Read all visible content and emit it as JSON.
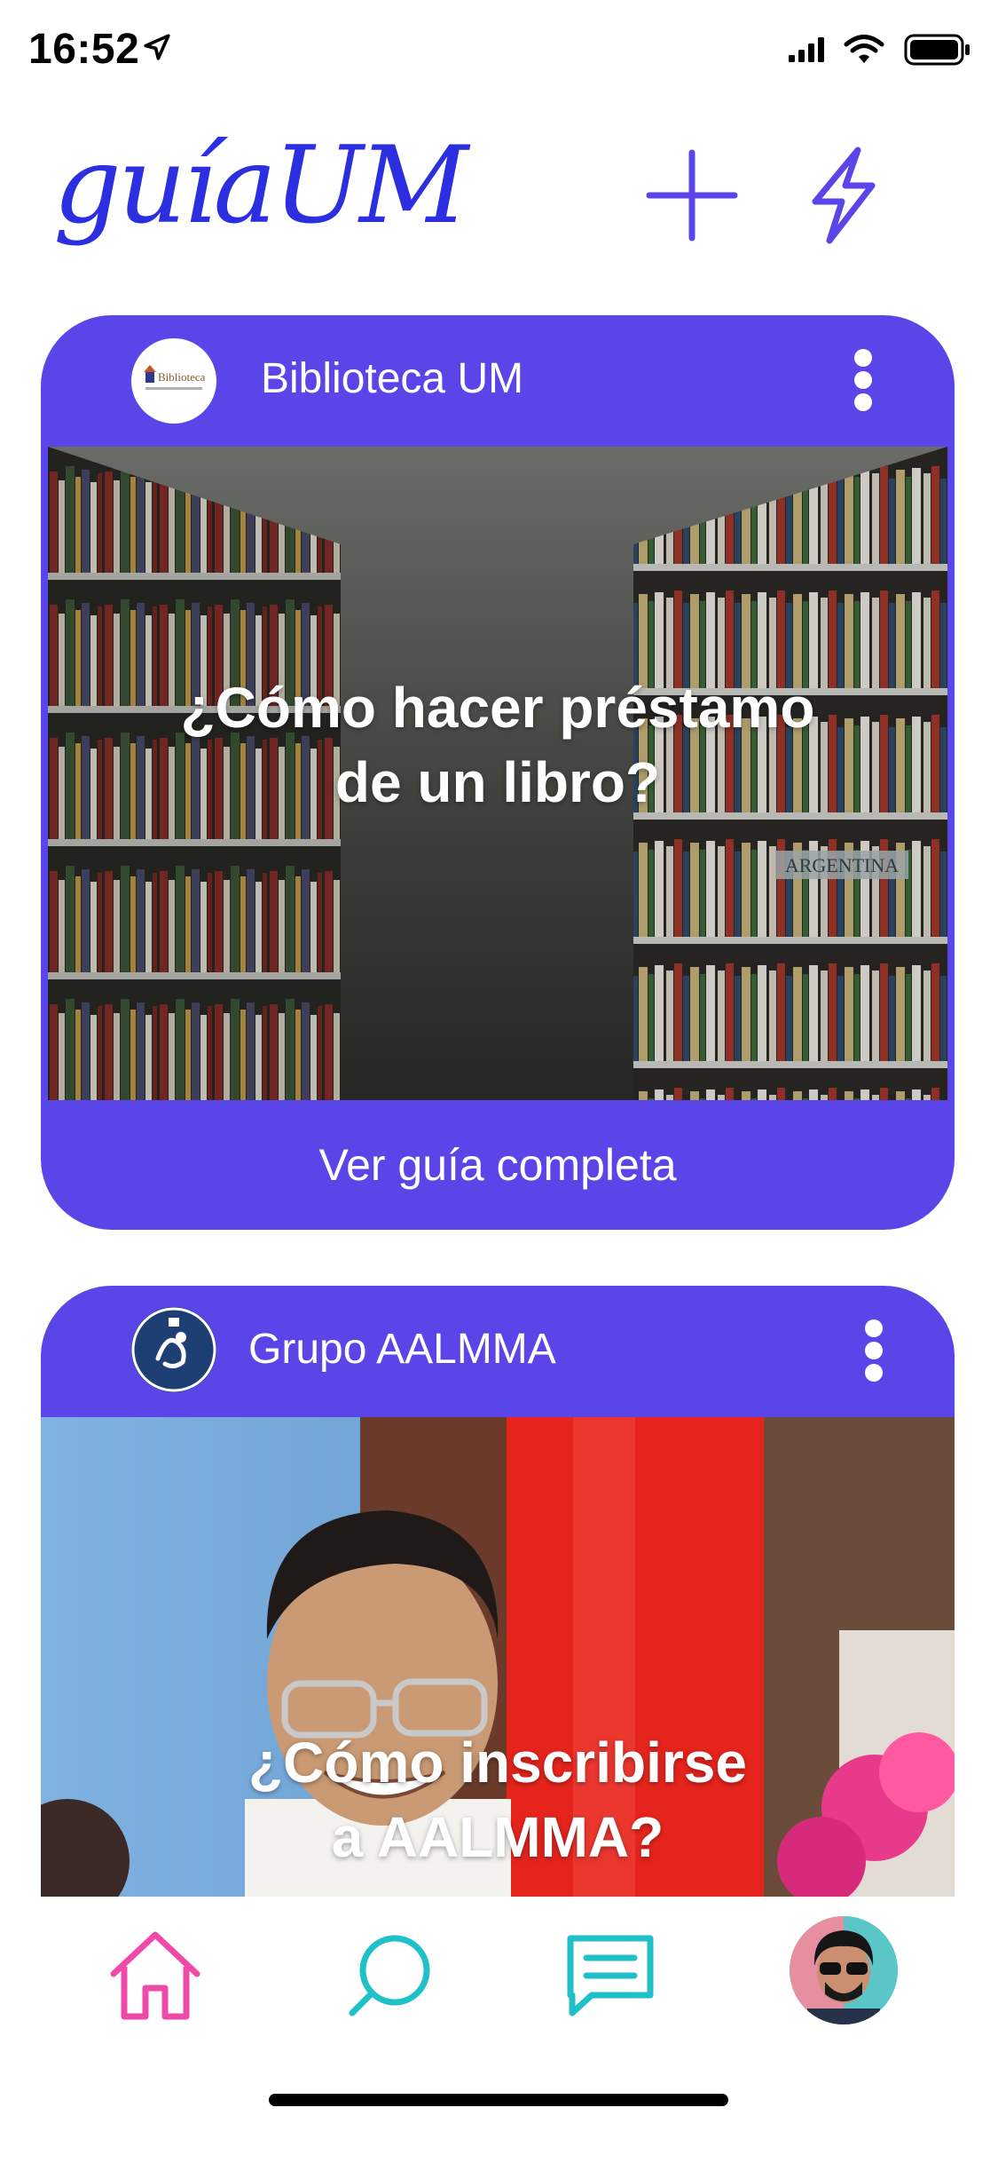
{
  "status_bar": {
    "time": "16:52"
  },
  "app": {
    "brand": "guíaUM"
  },
  "colors": {
    "brand": "#2b2fe0",
    "card": "#5945e8",
    "home": "#f04aa8",
    "accent": "#1fc0c7"
  },
  "cards": [
    {
      "author": "Biblioteca UM",
      "logo_text": "Biblioteca",
      "title_line1": "¿Cómo hacer préstamo",
      "title_line2": "de un libro?",
      "shelf_label": "ARGENTINA",
      "footer": "Ver guía completa"
    },
    {
      "author": "Grupo AALMMA",
      "title_line1": "¿Cómo inscribirse",
      "title_line2": "a AALMMA?"
    }
  ],
  "icons": {
    "status": [
      "location-arrow-icon",
      "signal-icon",
      "wifi-icon",
      "battery-icon"
    ],
    "header": [
      "plus-icon",
      "bolt-icon"
    ],
    "nav": [
      "home-icon",
      "search-icon",
      "chat-icon"
    ]
  }
}
